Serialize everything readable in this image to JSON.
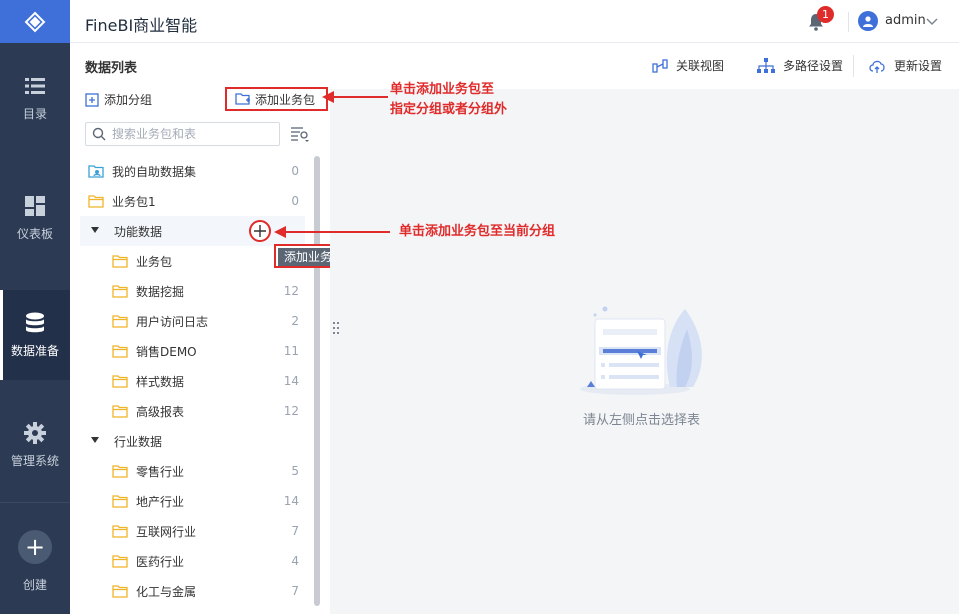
{
  "nav": {
    "items": [
      {
        "label": "目录",
        "icon": "list-icon"
      },
      {
        "label": "仪表板",
        "icon": "dashboard-icon"
      },
      {
        "label": "数据准备",
        "icon": "database-icon",
        "active": true
      },
      {
        "label": "管理系统",
        "icon": "gear-icon"
      }
    ],
    "create_label": "创建"
  },
  "header": {
    "title": "FineBI商业智能",
    "notification_count": "1",
    "username": "admin"
  },
  "panel": {
    "title": "数据列表",
    "add_group": "添加分组",
    "add_package": "添加业务包",
    "search_placeholder": "搜索业务包和表",
    "tooltip": "添加业务包"
  },
  "tree": [
    {
      "name": "我的自助数据集",
      "count": "0",
      "type": "selfdata"
    },
    {
      "name": "业务包1",
      "count": "0",
      "type": "folder"
    },
    {
      "name": "功能数据",
      "count": "",
      "type": "group"
    },
    {
      "name": "业务包",
      "count": "",
      "type": "folder",
      "child": true
    },
    {
      "name": "数据挖掘",
      "count": "12",
      "type": "folder",
      "child": true
    },
    {
      "name": "用户访问日志",
      "count": "2",
      "type": "folder",
      "child": true
    },
    {
      "name": "销售DEMO",
      "count": "11",
      "type": "folder",
      "child": true
    },
    {
      "name": "样式数据",
      "count": "14",
      "type": "folder",
      "child": true
    },
    {
      "name": "高级报表",
      "count": "12",
      "type": "folder",
      "child": true
    },
    {
      "name": "行业数据",
      "count": "",
      "type": "group"
    },
    {
      "name": "零售行业",
      "count": "5",
      "type": "folder",
      "child": true
    },
    {
      "name": "地产行业",
      "count": "14",
      "type": "folder",
      "child": true
    },
    {
      "name": "互联网行业",
      "count": "7",
      "type": "folder",
      "child": true
    },
    {
      "name": "医药行业",
      "count": "4",
      "type": "folder",
      "child": true
    },
    {
      "name": "化工与金属",
      "count": "7",
      "type": "folder",
      "child": true
    }
  ],
  "toolbar": {
    "relation_view": "关联视图",
    "multipath": "多路径设置",
    "update_settings": "更新设置"
  },
  "main": {
    "empty_text": "请从左侧点击选择表"
  },
  "annotations": {
    "a1_line1": "单击添加业务包至",
    "a1_line2": "指定分组或者分组外",
    "a2": "单击添加业务包至当前分组"
  },
  "colors": {
    "accent": "#3f6fd8",
    "nav_bg": "#2c3b53",
    "annotation": "#e02b2b",
    "folder": "#f0b429"
  }
}
